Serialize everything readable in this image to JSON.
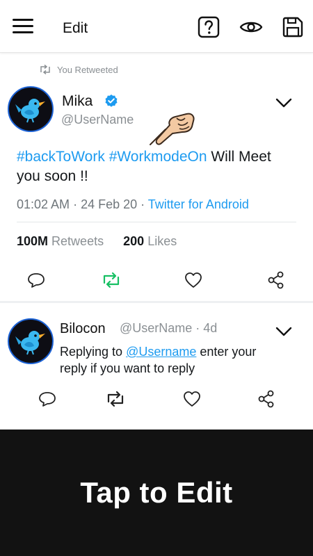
{
  "toolbar": {
    "title": "Edit",
    "icons": [
      "menu-icon",
      "help-icon",
      "eye-icon",
      "save-icon"
    ]
  },
  "retweet_notice": {
    "text": "You Retweeted",
    "icon": "retweet-icon"
  },
  "main_tweet": {
    "name": "Mika",
    "handle": "@UserName",
    "verified_icon": "verified-badge-icon",
    "hashtag1": "#backToWork",
    "hashtag2": "#WorkmodeOn",
    "text_rest": " Will Meet you soon !!",
    "time": "01:02 AM",
    "dot": " · ",
    "date": "24 Feb 20",
    "source": "Twitter for Android",
    "retweets_count": "100M",
    "retweets_label": "Retweets",
    "likes_count": "200",
    "likes_label": "Likes"
  },
  "reply_tweet": {
    "name": "Bilocon",
    "handle_time": "@UserName · 4d",
    "reply_prefix": "Replying to ",
    "mention": "@Username",
    "reply_rest": " enter your reply if you want to reply"
  },
  "banner": {
    "text": "Tap to Edit"
  },
  "colors": {
    "accent": "#1d9bf0",
    "retweet_active": "#17bf63",
    "banner_bg": "#121212"
  }
}
